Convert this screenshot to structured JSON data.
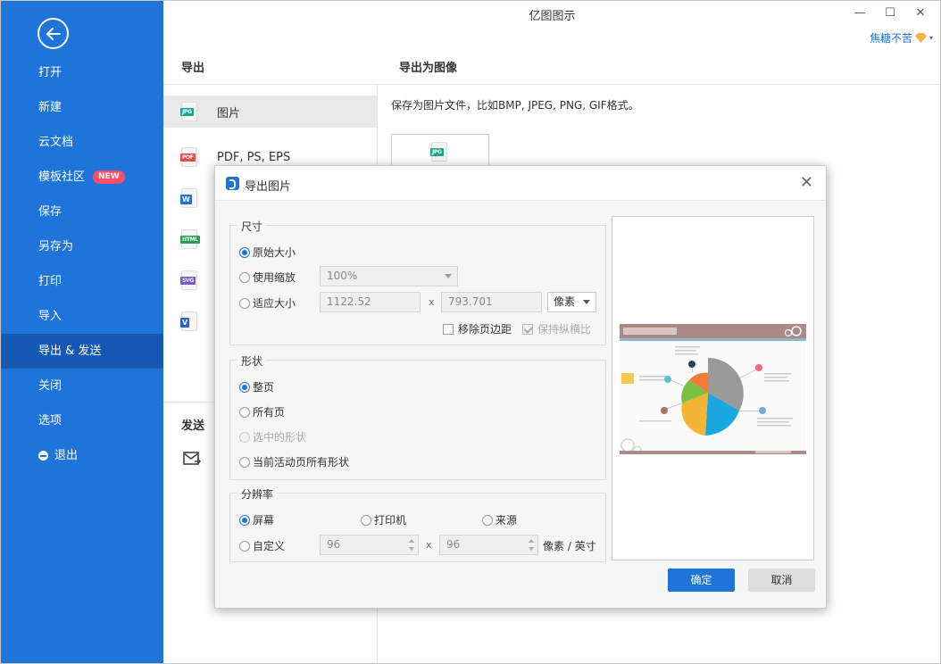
{
  "window": {
    "title": "亿图图示",
    "minimize_glyph": "—",
    "maximize_glyph": "☐",
    "close_glyph": "✕"
  },
  "user": {
    "name": "焦糖不苦",
    "caret": "▾"
  },
  "sidebar": {
    "items": [
      {
        "label": "打开"
      },
      {
        "label": "新建"
      },
      {
        "label": "云文档"
      },
      {
        "label": "模板社区",
        "badge": "NEW"
      },
      {
        "label": "保存"
      },
      {
        "label": "另存为"
      },
      {
        "label": "打印"
      },
      {
        "label": "导入"
      },
      {
        "label": "导出 & 发送",
        "active": true
      },
      {
        "label": "关闭"
      },
      {
        "label": "选项"
      },
      {
        "label": "退出"
      }
    ]
  },
  "export": {
    "header": "导出",
    "items": [
      {
        "label": "图片",
        "tag": "JPG",
        "color": "#21a38b"
      },
      {
        "label": "PDF, PS, EPS",
        "tag": "PDF",
        "color": "#e04c4c"
      },
      {
        "label": "",
        "tag": "W",
        "color": "#2b6fd6"
      },
      {
        "label": "",
        "tag": "HTML",
        "color": "#2b9a55"
      },
      {
        "label": "",
        "tag": "SVG",
        "color": "#7a58c8"
      },
      {
        "label": "",
        "tag": "V",
        "color": "#2b5fc8"
      }
    ],
    "send_header": "发送"
  },
  "image_panel": {
    "header": "导出为图像",
    "description": "保存为图片文件，比如BMP, JPEG, PNG, GIF格式。",
    "card_tag": "JPG"
  },
  "dialog": {
    "title": "导出图片",
    "close_glyph": "✕",
    "size_group": {
      "legend": "尺寸",
      "original_label": "原始大小",
      "scale_label": "使用缩放",
      "scale_value": "100%",
      "fit_label": "适应大小",
      "width_value": "1122.52",
      "x_label": "x",
      "height_value": "793.701",
      "unit_value": "像素",
      "remove_margin_label": "移除页边距",
      "keep_ratio_label": "保持纵横比"
    },
    "shape_group": {
      "legend": "形状",
      "whole_page_label": "整页",
      "all_pages_label": "所有页",
      "selected_label": "选中的形状",
      "current_page_label": "当前活动页所有形状"
    },
    "resolution_group": {
      "legend": "分辨率",
      "screen_label": "屏幕",
      "printer_label": "打印机",
      "source_label": "来源",
      "custom_label": "自定义",
      "dpi_x_value": "96",
      "x_label": "x",
      "dpi_y_value": "96",
      "unit_label": "像素 / 英寸"
    },
    "ok_label": "确定",
    "cancel_label": "取消"
  },
  "colors": {
    "sidebar": "#1e74d8",
    "sidebar_active": "#1559b4",
    "accent": "#1e74d8",
    "badge": "#ff4d6a"
  }
}
